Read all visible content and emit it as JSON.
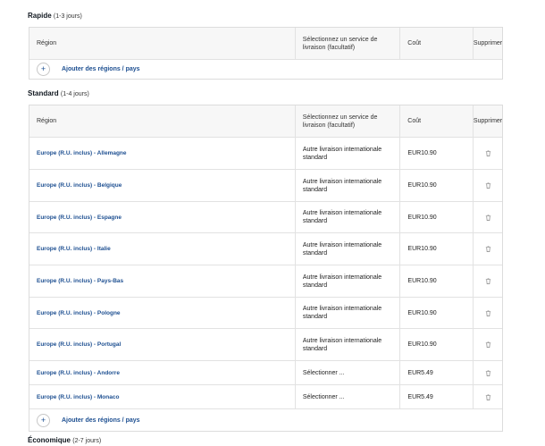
{
  "columns": {
    "region": "Région",
    "service": "Sélectionnez un service de livraison (facultatif)",
    "cost": "Coût",
    "delete": "Supprimer"
  },
  "add_label": "Ajouter des régions / pays",
  "rapide": {
    "name": "Rapide",
    "days": "(1-3 jours)"
  },
  "standard": {
    "name": "Standard",
    "days": "(1-4 jours)",
    "rows": [
      {
        "region": "Europe (R.U. inclus) - Allemagne",
        "service": "Autre livraison internationale standard",
        "cost": "EUR10.90"
      },
      {
        "region": "Europe (R.U. inclus) - Belgique",
        "service": "Autre livraison internationale standard",
        "cost": "EUR10.90"
      },
      {
        "region": "Europe (R.U. inclus) - Espagne",
        "service": "Autre livraison internationale standard",
        "cost": "EUR10.90"
      },
      {
        "region": "Europe (R.U. inclus) - Italie",
        "service": "Autre livraison internationale standard",
        "cost": "EUR10.90"
      },
      {
        "region": "Europe (R.U. inclus) - Pays-Bas",
        "service": "Autre livraison internationale standard",
        "cost": "EUR10.90"
      },
      {
        "region": "Europe (R.U. inclus) - Pologne",
        "service": "Autre livraison internationale standard",
        "cost": "EUR10.90"
      },
      {
        "region": "Europe (R.U. inclus) - Portugal",
        "service": "Autre livraison internationale standard",
        "cost": "EUR10.90"
      },
      {
        "region": "Europe (R.U. inclus) - Andorre",
        "service": "Sélectionner ...",
        "cost": "EUR5.49"
      },
      {
        "region": "Europe (R.U. inclus) - Monaco",
        "service": "Sélectionner ...",
        "cost": "EUR5.49"
      }
    ]
  },
  "economique": {
    "name": "Économique",
    "days": "(2-7 jours)"
  },
  "icons": {
    "add": "plus-circle-icon",
    "delete": "trash-icon"
  },
  "colors": {
    "link": "#1d4f91",
    "header_bg": "#f7f7f7",
    "border": "#e2e2e2"
  }
}
